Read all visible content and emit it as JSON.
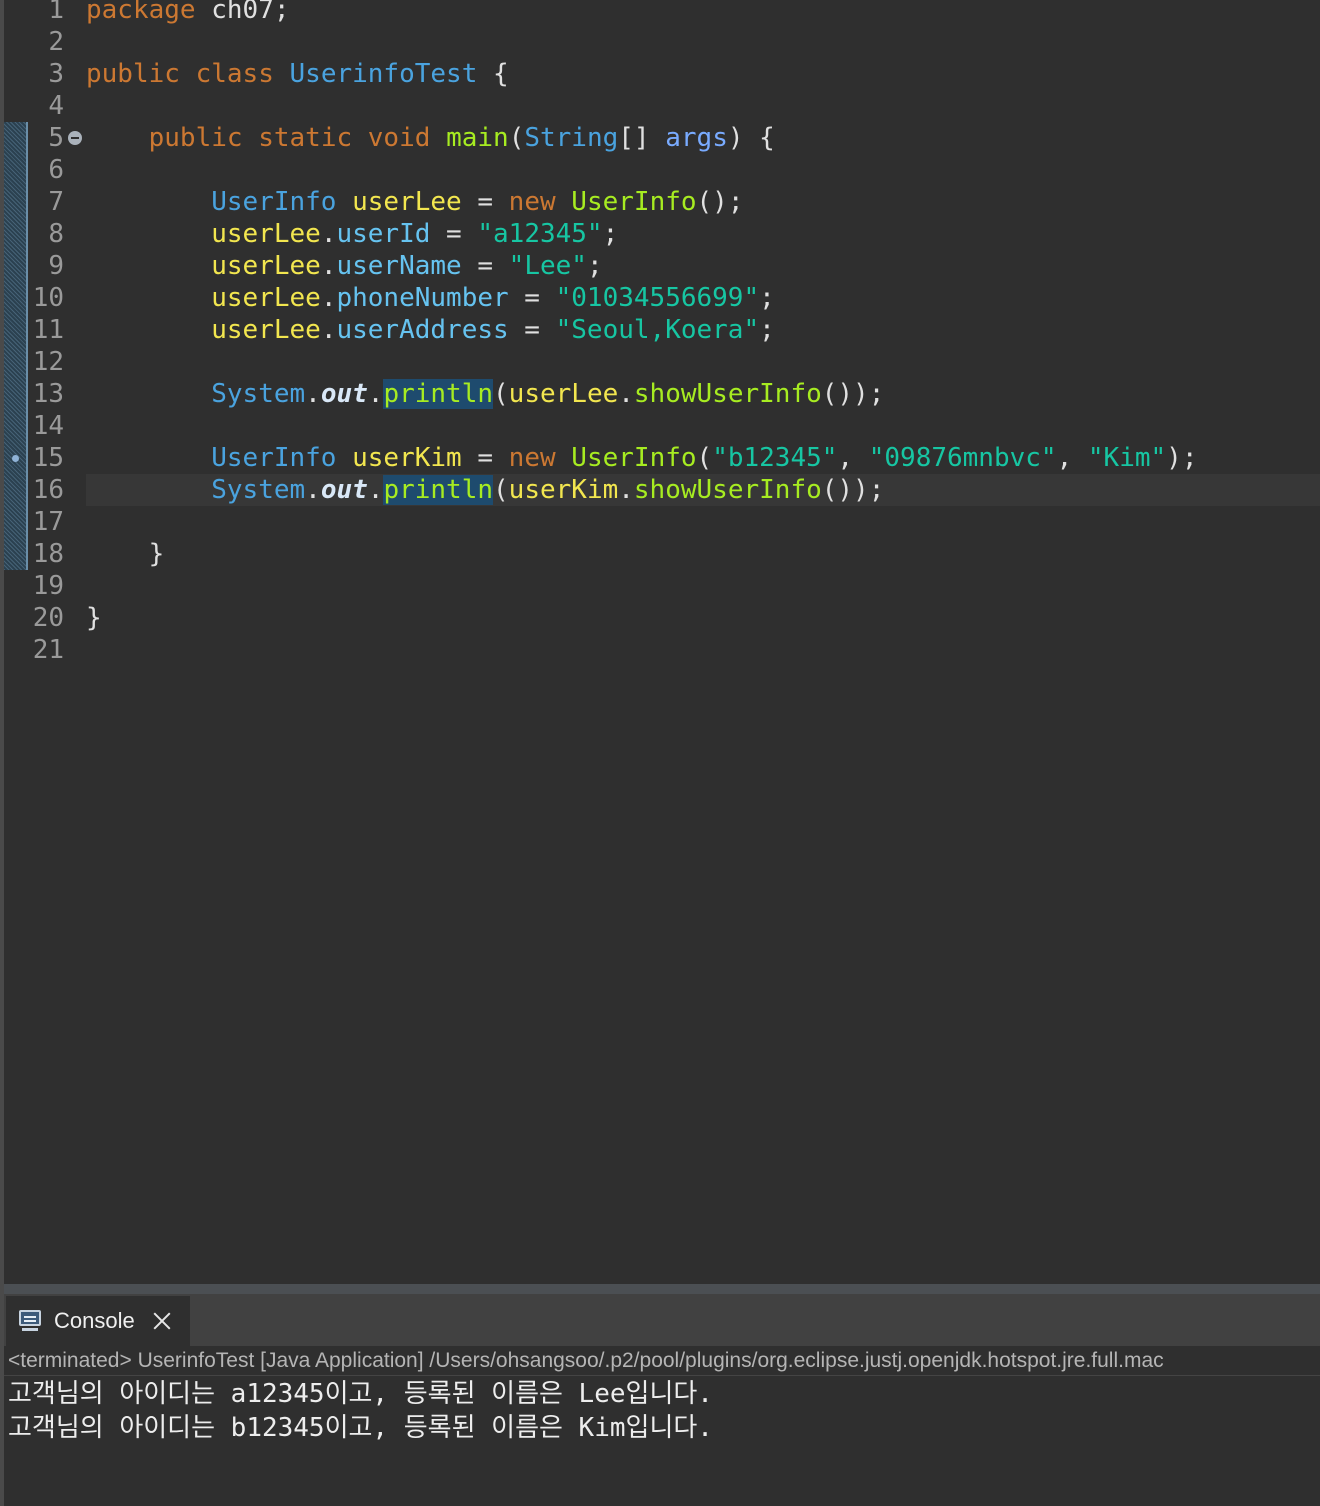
{
  "editor": {
    "line_numbers": [
      "1",
      "2",
      "3",
      "4",
      "5",
      "6",
      "7",
      "8",
      "9",
      "10",
      "11",
      "12",
      "13",
      "14",
      "15",
      "16",
      "17",
      "18",
      "19",
      "20",
      "21"
    ],
    "l1": {
      "kw": "package",
      "rest": " ch07;"
    },
    "l3": {
      "kw1": "public",
      "kw2": "class",
      "cls": "UserinfoTest",
      "brace": " {"
    },
    "l5": {
      "kw1": "public",
      "kw2": "static",
      "kw3": "void",
      "fn": "main",
      "p1": "(",
      "type": "String",
      "p2": "[] ",
      "param": "args",
      "p3": ") {"
    },
    "l7": {
      "type": "UserInfo",
      "var": "userLee",
      "eq": " = ",
      "kw": "new",
      "ctor": "UserInfo",
      "rest": "();"
    },
    "l8": {
      "var": "userLee",
      "dot": ".",
      "fld": "userId",
      "eq": " = ",
      "str": "\"a12345\"",
      "semi": ";"
    },
    "l9": {
      "var": "userLee",
      "dot": ".",
      "fld": "userName",
      "eq": " = ",
      "str": "\"Lee\"",
      "semi": ";"
    },
    "l10": {
      "var": "userLee",
      "dot": ".",
      "fld": "phoneNumber",
      "eq": " = ",
      "str": "\"01034556699\"",
      "semi": ";"
    },
    "l11": {
      "var": "userLee",
      "dot": ".",
      "fld": "userAddress",
      "eq": " = ",
      "str": "\"Seoul,Koera\"",
      "semi": ";"
    },
    "l13": {
      "sys": "System",
      "d1": ".",
      "out": "out",
      "d2": ".",
      "println": "println",
      "p1": "(",
      "var": "userLee",
      "d3": ".",
      "method": "showUserInfo",
      "rest": "());"
    },
    "l15": {
      "type": "UserInfo",
      "var": "userKim",
      "eq": " = ",
      "kw": "new",
      "ctor": "UserInfo",
      "p1": "(",
      "s1": "\"b12345\"",
      "c1": ", ",
      "s2": "\"09876mnbvc\"",
      "c2": ", ",
      "s3": "\"Kim\"",
      "rest": ");"
    },
    "l16": {
      "sys": "System",
      "d1": ".",
      "out": "out",
      "d2": ".",
      "println": "println",
      "p1": "(",
      "var": "userKim",
      "d3": ".",
      "method": "showUserInfo",
      "rest": "());"
    },
    "l18": "}",
    "l20": "}"
  },
  "console": {
    "tab_label": "Console",
    "header": "<terminated> UserinfoTest [Java Application] /Users/ohsangsoo/.p2/pool/plugins/org.eclipse.justj.openjdk.hotspot.jre.full.mac",
    "output": [
      "고객님의 아이디는 a12345이고, 등록된 이름은 Lee입니다.",
      "고객님의 아이디는 b12345이고, 등록된 이름은 Kim입니다."
    ]
  },
  "icons": [
    "fold-collapse-icon",
    "breakpoint-marker-icon",
    "console-icon",
    "close-icon"
  ]
}
